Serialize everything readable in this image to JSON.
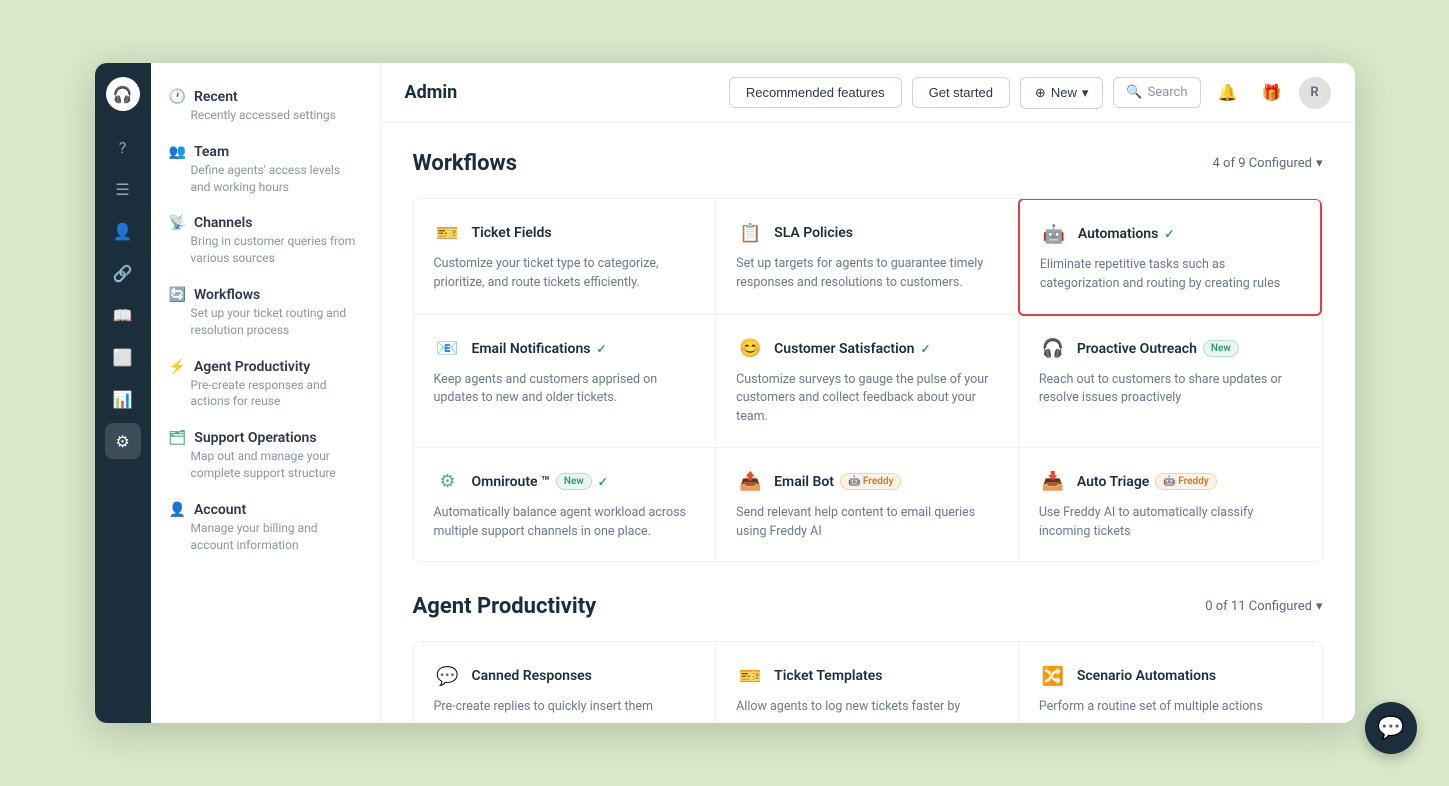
{
  "header": {
    "title": "Admin",
    "recommended_label": "Recommended features",
    "get_started_label": "Get started",
    "new_label": "New",
    "search_label": "Search",
    "avatar_label": "R"
  },
  "sidebar": {
    "items": [
      {
        "id": "recent",
        "icon": "🕐",
        "label": "Recent",
        "desc": "Recently accessed settings"
      },
      {
        "id": "team",
        "icon": "👥",
        "label": "Team",
        "desc": "Define agents' access levels and working hours"
      },
      {
        "id": "channels",
        "icon": "📡",
        "label": "Channels",
        "desc": "Bring in customer queries from various sources"
      },
      {
        "id": "workflows",
        "icon": "🔄",
        "label": "Workflows",
        "desc": "Set up your ticket routing and resolution process"
      },
      {
        "id": "agent-productivity",
        "icon": "⚡",
        "label": "Agent Productivity",
        "desc": "Pre-create responses and actions for reuse"
      },
      {
        "id": "support-operations",
        "icon": "🗂",
        "label": "Support Operations",
        "desc": "Map out and manage your complete support structure"
      },
      {
        "id": "account",
        "icon": "👤",
        "label": "Account",
        "desc": "Manage your billing and account information"
      }
    ]
  },
  "nav_icons": [
    "?",
    "☰",
    "👤",
    "🔗",
    "📖",
    "⬜",
    "📊",
    "⚙"
  ],
  "workflows_section": {
    "title": "Workflows",
    "config_label": "4 of 9 Configured",
    "features": [
      {
        "id": "ticket-fields",
        "icon": "🎫",
        "icon_color": "#4caf8a",
        "name": "Ticket Fields",
        "desc": "Customize your ticket type to categorize, prioritize, and route tickets efficiently.",
        "badge": null,
        "highlighted": false
      },
      {
        "id": "sla-policies",
        "icon": "📋",
        "icon_color": "#5b8dd9",
        "name": "SLA Policies",
        "desc": "Set up targets for agents to guarantee timely responses and resolutions to customers.",
        "badge": null,
        "highlighted": false
      },
      {
        "id": "automations",
        "icon": "🤖",
        "icon_color": "#5b8dd9",
        "name": "Automations",
        "desc": "Eliminate repetitive tasks such as categorization and routing by creating rules",
        "badge": "check",
        "highlighted": true
      },
      {
        "id": "email-notifications",
        "icon": "📧",
        "icon_color": "#4caf8a",
        "name": "Email Notifications",
        "desc": "Keep agents and customers apprised on updates to new and older tickets.",
        "badge": "check",
        "highlighted": false
      },
      {
        "id": "customer-satisfaction",
        "icon": "😊",
        "icon_color": "#f0a030",
        "name": "Customer Satisfaction",
        "desc": "Customize surveys to gauge the pulse of your customers and collect feedback about your team.",
        "badge": "check",
        "highlighted": false
      },
      {
        "id": "proactive-outreach",
        "icon": "🎧",
        "icon_color": "#5b8dd9",
        "name": "Proactive Outreach",
        "desc": "Reach out to customers to share updates or resolve issues proactively",
        "badge": "new",
        "highlighted": false
      },
      {
        "id": "omniroute",
        "icon": "⚙",
        "icon_color": "#4caf8a",
        "name": "Omniroute ™",
        "desc": "Automatically balance agent workload across multiple support channels in one place.",
        "badge": "new-check",
        "highlighted": false
      },
      {
        "id": "email-bot",
        "icon": "📤",
        "icon_color": "#5b8dd9",
        "name": "Email Bot",
        "desc": "Send relevant help content to email queries using Freddy AI",
        "badge": "freddy",
        "highlighted": false
      },
      {
        "id": "auto-triage",
        "icon": "📥",
        "icon_color": "#f0a030",
        "name": "Auto Triage",
        "desc": "Use Freddy AI to automatically classify incoming tickets",
        "badge": "freddy",
        "highlighted": false
      }
    ]
  },
  "agent_productivity_section": {
    "title": "Agent Productivity",
    "config_label": "0 of 11 Configured",
    "features": [
      {
        "id": "canned-responses",
        "icon": "💬",
        "icon_color": "#e05a2b",
        "name": "Canned Responses",
        "desc": "Pre-create replies to quickly insert them",
        "badge": null
      },
      {
        "id": "ticket-templates",
        "icon": "🎫",
        "icon_color": "#5b8dd9",
        "name": "Ticket Templates",
        "desc": "Allow agents to log new tickets faster by",
        "badge": null
      },
      {
        "id": "scenario-automations",
        "icon": "🔀",
        "icon_color": "#e05a2b",
        "name": "Scenario Automations",
        "desc": "Perform a routine set of multiple actions",
        "badge": null
      }
    ]
  }
}
